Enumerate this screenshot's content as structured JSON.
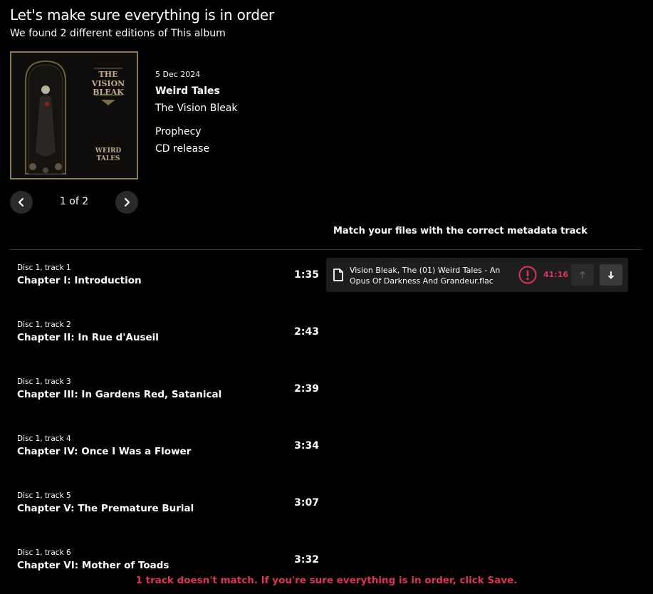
{
  "page": {
    "heading": "Let's make sure everything is in order",
    "subheading": "We found 2 different editions of This album"
  },
  "release": {
    "date": "5 Dec 2024",
    "title": "Weird Tales",
    "artist": "The Vision Bleak",
    "label": "Prophecy",
    "format": "CD release",
    "cover_text_top": "THE VISION BLEAK",
    "cover_text_bottom": "WEIRD TALES"
  },
  "pager": {
    "text": "1 of 2"
  },
  "match_heading": "Match your files with the correct metadata track",
  "tracks": [
    {
      "pos": "Disc 1, track 1",
      "name": "Chapter I: Introduction",
      "duration": "1:35"
    },
    {
      "pos": "Disc 1, track 2",
      "name": "Chapter II: In Rue d'Auseil",
      "duration": "2:43"
    },
    {
      "pos": "Disc 1, track 3",
      "name": "Chapter III: In Gardens Red, Satanical",
      "duration": "2:39"
    },
    {
      "pos": "Disc 1, track 4",
      "name": "Chapter IV: Once I Was a Flower",
      "duration": "3:34"
    },
    {
      "pos": "Disc 1, track 5",
      "name": "Chapter V: The Premature Burial",
      "duration": "3:07"
    },
    {
      "pos": "Disc 1, track 6",
      "name": "Chapter VI: Mother of Toads",
      "duration": "3:32"
    }
  ],
  "file": {
    "name": "Vision Bleak, The (01) Weird Tales - An Opus Of Darkness And Grandeur.flac",
    "duration": "41:16",
    "icon": "file-icon",
    "warning_icon": "warning-icon"
  },
  "footer_message": "1 track doesn't match. If you're sure everything is in order, click Save.",
  "colors": {
    "accent_error": "#e0315a",
    "background": "#000000",
    "card": "#1e1e1e"
  }
}
